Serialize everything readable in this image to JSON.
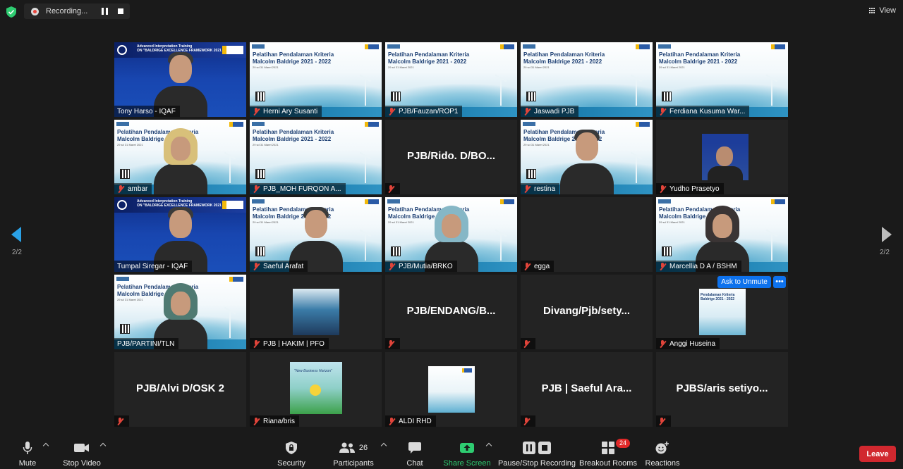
{
  "topbar": {
    "recording_label": "Recording...",
    "view_label": "View"
  },
  "tiles": [
    {
      "name": "Tony Harso - IQAF",
      "muted": false,
      "kind": "video",
      "bg": "conf"
    },
    {
      "name": "Herni Ary Susanti",
      "muted": true,
      "kind": "slide"
    },
    {
      "name": "PJB/Fauzan/ROP1",
      "muted": true,
      "kind": "slide"
    },
    {
      "name": "Jaswadi PJB",
      "muted": true,
      "kind": "slide"
    },
    {
      "name": "Ferdiana Kusuma War...",
      "muted": true,
      "kind": "slide"
    },
    {
      "name": "ambar",
      "muted": true,
      "kind": "video",
      "bg": "slide"
    },
    {
      "name": "PJB_MOH FURQON A...",
      "muted": true,
      "kind": "slide"
    },
    {
      "name": "PJB/Rido. D/BO...",
      "muted": true,
      "kind": "noname"
    },
    {
      "name": "restina",
      "muted": true,
      "kind": "video",
      "bg": "slide"
    },
    {
      "name": "Yudho Prasetyo",
      "muted": true,
      "kind": "thumb"
    },
    {
      "name": "Tumpal Siregar - IQAF",
      "muted": false,
      "kind": "video",
      "bg": "conf",
      "active": true
    },
    {
      "name": "Saeful Arafat",
      "muted": true,
      "kind": "video",
      "bg": "slide"
    },
    {
      "name": "PJB/Mutia/BRKO",
      "muted": true,
      "kind": "video",
      "bg": "slide"
    },
    {
      "name": "egga",
      "muted": true,
      "kind": "empty"
    },
    {
      "name": "Marcellia D A / BSHM",
      "muted": true,
      "kind": "video",
      "bg": "slide"
    },
    {
      "name": "PJB/PARTINI/TLN",
      "muted": false,
      "kind": "video",
      "bg": "slide"
    },
    {
      "name": "PJB | HAKIM | PFO",
      "muted": true,
      "kind": "thumb"
    },
    {
      "name": "PJB/ENDANG/B...",
      "muted": true,
      "kind": "noname"
    },
    {
      "name": "Divang/Pjb/sety...",
      "muted": true,
      "kind": "noname"
    },
    {
      "name": "Anggi Huseina",
      "muted": true,
      "kind": "thumb"
    },
    {
      "name": "PJB/Alvi D/OSK 2",
      "muted": true,
      "kind": "noname"
    },
    {
      "name": "Riana/bris",
      "muted": true,
      "kind": "thumb"
    },
    {
      "name": "ALDI RHD",
      "muted": true,
      "kind": "thumb"
    },
    {
      "name": "PJB | Saeful Ara...",
      "muted": true,
      "kind": "noname"
    },
    {
      "name": "PJBS/aris  setiyo...",
      "muted": true,
      "kind": "noname"
    }
  ],
  "slide": {
    "title_line1": "Pelatihan Pendalaman Kriteria",
    "title_line2": "Malcolm Baldrige 2021 - 2022",
    "date": "29 sd 31 Maret 2021"
  },
  "conf_banner": {
    "title": "Advanced Interpretation Training",
    "subtitle": "ON \"BALDRIGE EXCELLENCE FRAMEWORK 2021 - 2022\""
  },
  "thumb_texts": {
    "anggi": "Pendalaman Kriteria Baldrige 2021 - 2022",
    "riana": "\"New Business Horizon\""
  },
  "ask_to_unmute": "Ask to Unmute",
  "more_options": "•••",
  "pagination": {
    "left": "2/2",
    "right": "2/2"
  },
  "toolbar": {
    "mute": "Mute",
    "stop_video": "Stop Video",
    "security": "Security",
    "participants": "Participants",
    "participants_count": "26",
    "chat": "Chat",
    "share_screen": "Share Screen",
    "pause_stop_recording": "Pause/Stop Recording",
    "breakout_rooms": "Breakout Rooms",
    "breakout_badge": "24",
    "reactions": "Reactions",
    "leave": "Leave"
  },
  "colors": {
    "accent_blue": "#0e72ed",
    "share_green": "#2ecc71",
    "leave_red": "#d1282f",
    "active_speaker": "#e9e36a",
    "muted_red": "#e0443a"
  }
}
